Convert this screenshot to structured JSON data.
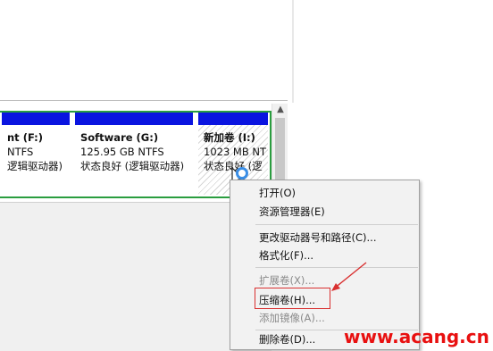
{
  "volumes": [
    {
      "name": "nt  (F:)",
      "size": "NTFS",
      "status": "逻辑驱动器)"
    },
    {
      "name": "Software  (G:)",
      "size": "125.95 GB NTFS",
      "status": "状态良好 (逻辑驱动器)"
    },
    {
      "name": "新加卷  (I:)",
      "size": "1023 MB NT",
      "status": "状态良好 (逻"
    }
  ],
  "context_menu": {
    "items": [
      {
        "label": "打开(O)",
        "enabled": true
      },
      {
        "label": "资源管理器(E)",
        "enabled": true
      },
      {
        "label": "更改驱动器号和路径(C)...",
        "enabled": true
      },
      {
        "label": "格式化(F)...",
        "enabled": true
      },
      {
        "label": "扩展卷(X)...",
        "enabled": false
      },
      {
        "label": "压缩卷(H)...",
        "enabled": true,
        "highlighted": true
      },
      {
        "label": "添加镜像(A)...",
        "enabled": false
      },
      {
        "label": "删除卷(D)...",
        "enabled": true
      }
    ]
  },
  "watermark": "www.acang.cn",
  "colors": {
    "volume_header": "#0a14e0",
    "selected_outline": "#2a9d3f",
    "annotation_red": "#d93030",
    "watermark_red": "#e81010"
  }
}
